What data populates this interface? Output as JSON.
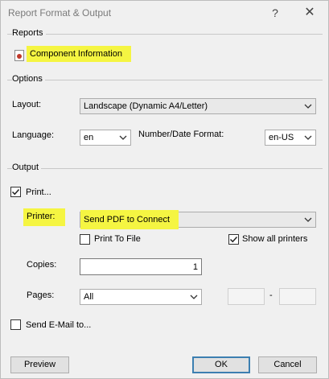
{
  "window": {
    "title": "Report Format & Output",
    "help_glyph": "?",
    "close_glyph": "✕"
  },
  "reports": {
    "group_label": "Reports",
    "items": [
      {
        "label": "Component Information",
        "icon": "report-icon"
      }
    ]
  },
  "options": {
    "group_label": "Options",
    "layout_label": "Layout:",
    "layout_value": "Landscape (Dynamic A4/Letter)",
    "language_label": "Language:",
    "language_value": "en",
    "number_date_label": "Number/Date Format:",
    "number_date_value": "en-US"
  },
  "output": {
    "group_label": "Output",
    "print_label": "Print...",
    "print_checked": true,
    "printer_label": "Printer:",
    "printer_value": "Send PDF to Connect",
    "print_to_file_label": "Print To File",
    "print_to_file_checked": false,
    "show_all_printers_label": "Show all printers",
    "show_all_printers_checked": true,
    "copies_label": "Copies:",
    "copies_value": "1",
    "pages_label": "Pages:",
    "pages_value": "All",
    "pages_from": "",
    "pages_separator": "-",
    "pages_to": "",
    "send_email_label": "Send E-Mail to...",
    "send_email_checked": false
  },
  "buttons": {
    "preview": "Preview",
    "ok": "OK",
    "cancel": "Cancel"
  },
  "colors": {
    "highlight": "#f5f542",
    "default_button_border": "#3c7fb1"
  }
}
